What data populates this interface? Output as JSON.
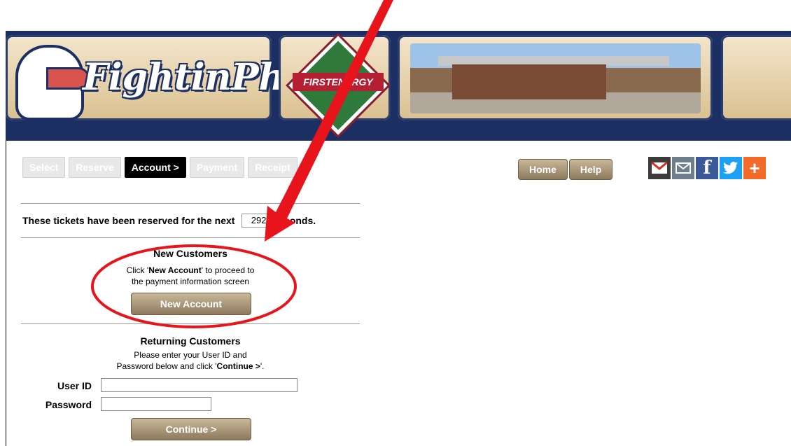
{
  "banner": {
    "logo_text": "FightinPhils.",
    "stadium_text": "FIRSTENERGY"
  },
  "steps": [
    "Select",
    "Reserve",
    "Account >",
    "Payment",
    "Receipt"
  ],
  "top_buttons": {
    "home": "Home",
    "help": "Help"
  },
  "social": {
    "facebook_glyph": "f",
    "plus_glyph": "+"
  },
  "reservation": {
    "prefix": "These tickets have been reserved for the next",
    "seconds": "292",
    "suffix": "seconds."
  },
  "new_customers": {
    "heading": "New Customers",
    "line1_pre": "Click '",
    "line1_bold": "New Account",
    "line1_post": "' to proceed to",
    "line2": "the payment information screen",
    "button": "New Account"
  },
  "returning_customers": {
    "heading": "Returning Customers",
    "line1": "Please enter your User ID and",
    "line2_pre": "Password below and click '",
    "line2_bold": "Continue >",
    "line2_post": "'.",
    "user_id_label": "User ID",
    "password_label": "Password",
    "user_id_value": "",
    "password_value": "",
    "button": "Continue >"
  },
  "colors": {
    "banner": "#1c2f63",
    "annotation_red": "#e8141b",
    "bronze_button": "#a8967a"
  }
}
